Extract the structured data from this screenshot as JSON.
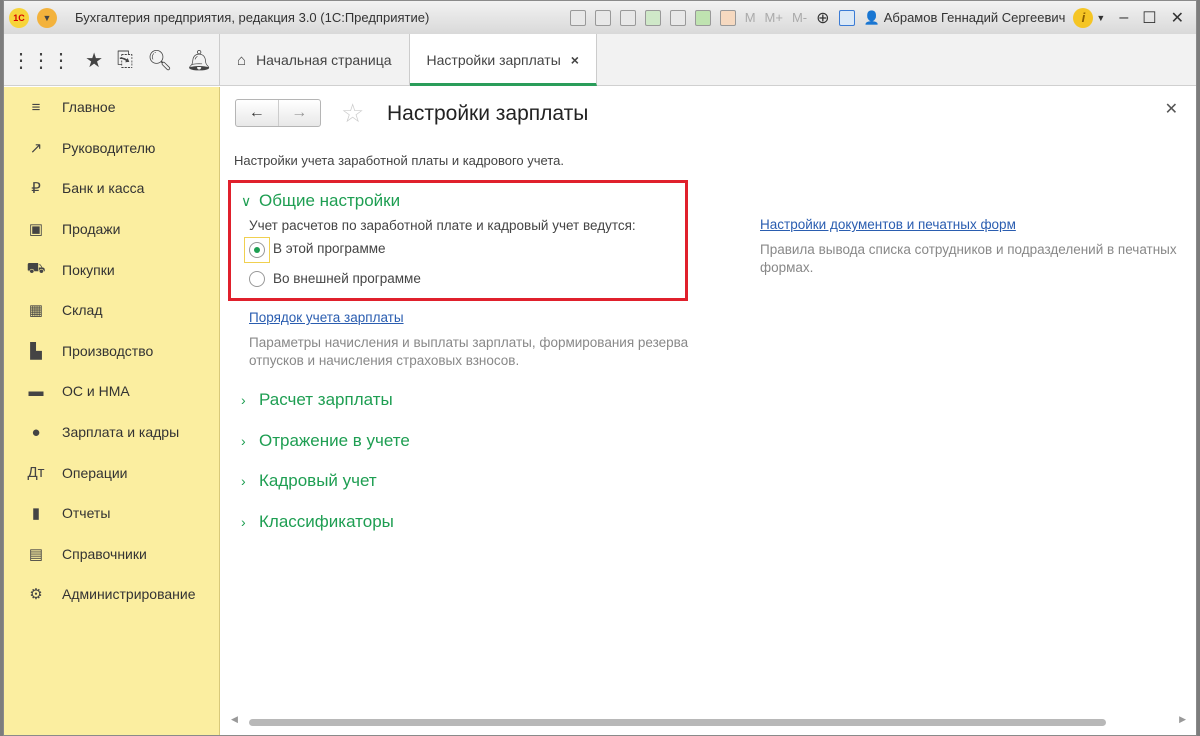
{
  "titlebar": {
    "logo": "1С",
    "title": "Бухгалтерия предприятия, редакция 3.0  (1С:Предприятие)",
    "memory": [
      "M",
      "M+",
      "M-"
    ],
    "user": "Абрамов Геннадий Сергеевич",
    "info": "i"
  },
  "tabs": [
    {
      "label": "Начальная страница"
    },
    {
      "label": "Настройки зарплаты",
      "close": "×"
    }
  ],
  "sidebar": {
    "items": [
      {
        "label": "Главное",
        "icon": "≡"
      },
      {
        "label": "Руководителю",
        "icon": "↗"
      },
      {
        "label": "Банк и касса",
        "icon": "₽"
      },
      {
        "label": "Продажи",
        "icon": "▣"
      },
      {
        "label": "Покупки",
        "icon": "⛟"
      },
      {
        "label": "Склад",
        "icon": "▦"
      },
      {
        "label": "Производство",
        "icon": "▙"
      },
      {
        "label": "ОС и НМА",
        "icon": "▬"
      },
      {
        "label": "Зарплата и кадры",
        "icon": "●"
      },
      {
        "label": "Операции",
        "icon": "Дт"
      },
      {
        "label": "Отчеты",
        "icon": "▮"
      },
      {
        "label": "Справочники",
        "icon": "▤"
      },
      {
        "label": "Администрирование",
        "icon": "⚙"
      }
    ]
  },
  "form": {
    "title": "Настройки зарплаты",
    "description": "Настройки учета заработной платы и кадрового учета.",
    "general": {
      "title": "Общие настройки",
      "question": "Учет расчетов по заработной плате и кадровый учет ведутся:",
      "options": [
        "В этой программе",
        "Во внешней программе"
      ],
      "selected": 0
    },
    "link1": {
      "label": "Порядок учета зарплаты",
      "hint": "Параметры начисления и выплаты зарплаты, формирования резерва отпусков и начисления страховых взносов."
    },
    "link2": {
      "label": "Настройки документов и печатных форм",
      "hint": "Правила вывода списка сотрудников и подразделений в печатных формах."
    },
    "sections": [
      "Расчет зарплаты",
      "Отражение в учете",
      "Кадровый учет",
      "Классификаторы"
    ]
  }
}
